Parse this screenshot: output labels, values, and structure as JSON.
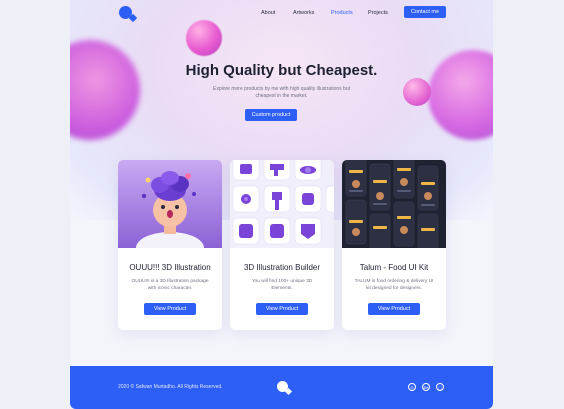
{
  "nav": {
    "items": [
      {
        "label": "About"
      },
      {
        "label": "Artworks"
      },
      {
        "label": "Products",
        "active": true
      },
      {
        "label": "Projects"
      }
    ],
    "contact_label": "Contact me"
  },
  "hero": {
    "title": "High Quality but Cheapest.",
    "description": "Explore more products by me with high quality illustrations but cheapest in the market.",
    "button_label": "Custom product"
  },
  "cards": [
    {
      "title": "OUUU!!! 3D Illustration",
      "description": "OUUU!!! is a 3D Illustration package with iconic character.",
      "button_label": "View Product"
    },
    {
      "title": "3D Illustration Builder",
      "description": "You will find 100+ unique 3D Elements.",
      "button_label": "View Product"
    },
    {
      "title": "Talum - Food UI Kit",
      "description": "TALUM is food ordering & delivery UI kit designed for designers.",
      "button_label": "View Product"
    }
  ],
  "footer": {
    "copyright": "2020 © Safwan Murtadho. All Rights Reserved.",
    "social": [
      {
        "icon": "dribbble-icon",
        "glyph": "◎"
      },
      {
        "icon": "behance-icon",
        "glyph": "Bē"
      },
      {
        "icon": "instagram-icon",
        "glyph": "◻"
      }
    ]
  },
  "colors": {
    "accent": "#2d5ef5",
    "background": "#f4f5fb"
  }
}
